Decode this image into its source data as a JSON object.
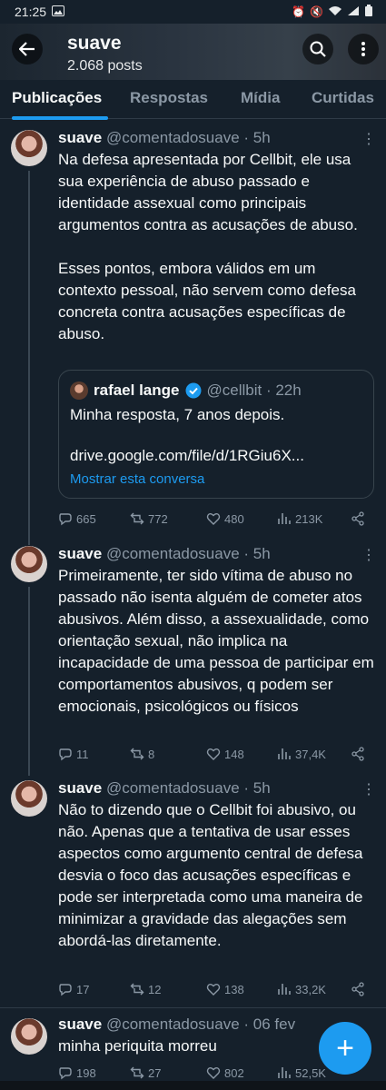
{
  "status_bar": {
    "time": "21:25"
  },
  "header": {
    "title": "suave",
    "post_count": "2.068 posts"
  },
  "tabs": [
    {
      "label": "Publicações",
      "active": true
    },
    {
      "label": "Respostas",
      "active": false
    },
    {
      "label": "Mídia",
      "active": false
    },
    {
      "label": "Curtidas",
      "active": false
    }
  ],
  "posts": [
    {
      "name": "suave",
      "meta": "@comentadosuave · 5h",
      "text": "Na defesa apresentada por Cellbit, ele usa sua experiência de abuso passado e identidade assexual como principais argumentos contra as acusações de abuso.\n\nEsses pontos, embora válidos em um contexto pessoal, não servem como defesa concreta contra acusações específicas de abuso.",
      "quote": {
        "name": "rafael lange",
        "handle_time": "@cellbit · 22h",
        "text": "Minha resposta, 7 anos depois.",
        "link": "drive.google.com/file/d/1RGiu6X...",
        "show_thread": "Mostrar esta conversa"
      },
      "replies": "665",
      "reposts": "772",
      "likes": "480",
      "views": "213K"
    },
    {
      "name": "suave",
      "meta": "@comentadosuave · 5h",
      "text": "Primeiramente, ter sido vítima de abuso no passado não isenta alguém de cometer atos abusivos. Além disso, a assexualidade, como orientação sexual, não implica na incapacidade de uma pessoa de participar em comportamentos abusivos, q podem ser emocionais, psicológicos ou físicos",
      "replies": "11",
      "reposts": "8",
      "likes": "148",
      "views": "37,4K"
    },
    {
      "name": "suave",
      "meta": "@comentadosuave · 5h",
      "text": "Não to dizendo que o Cellbit foi abusivo, ou não. Apenas que a tentativa de usar esses aspectos como argumento central de defesa desvia o foco das acusações específicas e pode ser interpretada como uma maneira de minimizar a gravidade das alegações sem abordá-las diretamente.",
      "replies": "17",
      "reposts": "12",
      "likes": "138",
      "views": "33,2K"
    },
    {
      "name": "suave",
      "meta": "@comentadosuave · 06 fev",
      "text": "minha periquita morreu",
      "replies": "198",
      "reposts": "27",
      "likes": "802",
      "views": "52,5K"
    }
  ],
  "colors": {
    "accent": "#1d9bf0",
    "background": "#15202b",
    "muted": "#8b98a5"
  }
}
